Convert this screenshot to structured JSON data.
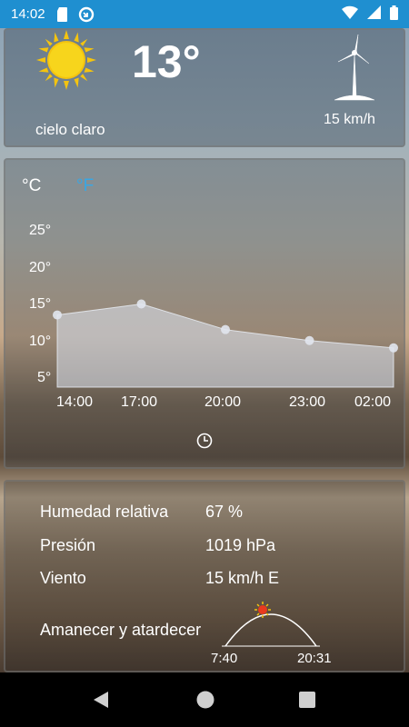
{
  "status_bar": {
    "time": "14:02"
  },
  "current": {
    "temperature": "13°",
    "condition": "cielo claro",
    "wind": "15 km/h",
    "weather_icon": "sun-icon",
    "wind_icon": "wind-turbine-icon"
  },
  "chart": {
    "unit_c": "°C",
    "unit_f": "°F",
    "clock_icon": "clock-icon"
  },
  "chart_data": {
    "type": "area",
    "x": [
      "14:00",
      "17:00",
      "20:00",
      "23:00",
      "02:00"
    ],
    "y_ticks": [
      "25°",
      "20°",
      "15°",
      "10°",
      "5°"
    ],
    "ylim": [
      5,
      25
    ],
    "series": [
      {
        "values": [
          13.5,
          15,
          11.5,
          10,
          9
        ]
      }
    ]
  },
  "details": {
    "humidity_label": "Humedad relativa",
    "humidity_value": "67 %",
    "pressure_label": "Presión",
    "pressure_value": "1019 hPa",
    "wind_label": "Viento",
    "wind_value": "15 km/h E",
    "sun_label": "Amanecer y atardecer",
    "sunrise": "7:40",
    "sunset": "20:31"
  },
  "colors": {
    "status_bar": "#1f8fd0",
    "accent": "#39a7e4"
  }
}
